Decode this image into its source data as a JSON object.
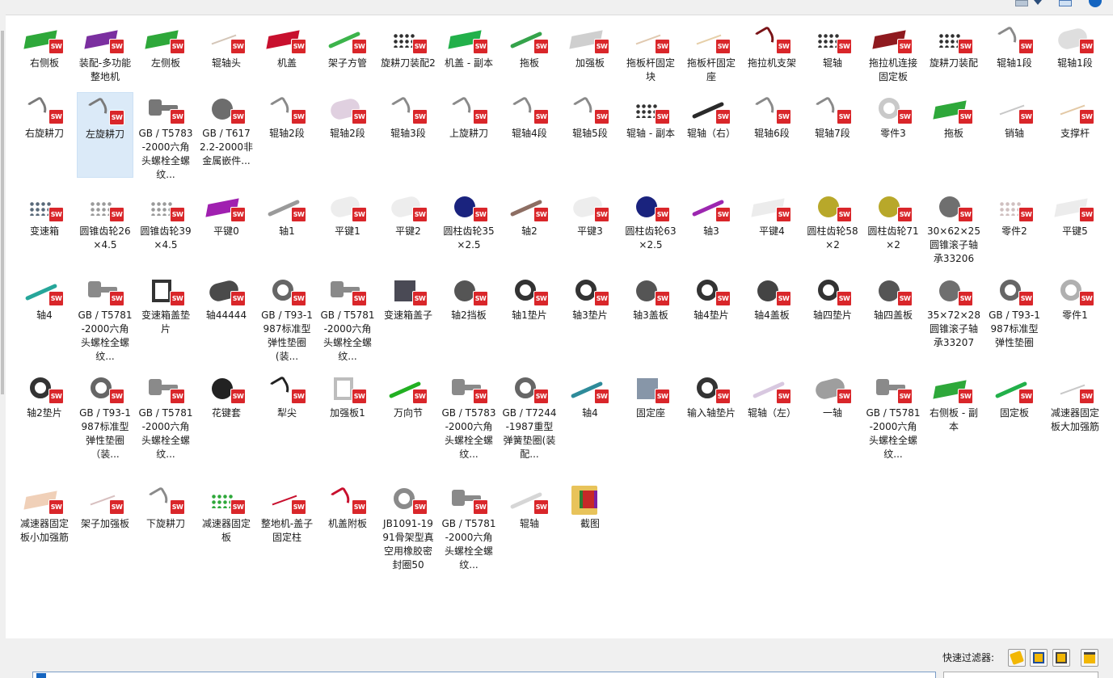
{
  "items": [
    {
      "label": "右侧板",
      "icon": "green-plate-part",
      "color": "#2ea83a",
      "shape": "slab"
    },
    {
      "label": "装配-多功能整地机",
      "icon": "purple-machine-assembly",
      "color": "#7b2fa0",
      "shape": "slab"
    },
    {
      "label": "左侧板",
      "icon": "green-plate-part",
      "color": "#2ea83a",
      "shape": "slab"
    },
    {
      "label": "辊轴头",
      "icon": "small-shaft-end-part",
      "color": "#d4c6b8",
      "shape": "thin"
    },
    {
      "label": "机盖",
      "icon": "red-cover-part",
      "color": "#c8102e",
      "shape": "slab"
    },
    {
      "label": "架子方管",
      "icon": "green-tube-part",
      "color": "#3cb44b",
      "shape": "rod"
    },
    {
      "label": "旋耕刀装配2",
      "icon": "tiller-blade-assembly",
      "color": "#2f2f2f",
      "shape": "dots"
    },
    {
      "label": "机盖 - 副本",
      "icon": "green-cover-part",
      "color": "#22b04a",
      "shape": "slab"
    },
    {
      "label": "拖板",
      "icon": "green-drag-board-part",
      "color": "#35a34b",
      "shape": "rod"
    },
    {
      "label": "加强板",
      "icon": "gray-reinforce-plate-part",
      "color": "#cfcfcf",
      "shape": "slab"
    },
    {
      "label": "拖板杆固定块",
      "icon": "small-block-part",
      "color": "#e0c9b0",
      "shape": "thin"
    },
    {
      "label": "拖板杆固定座",
      "icon": "small-seat-part",
      "color": "#e6cfa8",
      "shape": "thin"
    },
    {
      "label": "拖拉机支架",
      "icon": "dark-red-bracket-part",
      "color": "#7a1418",
      "shape": "blade"
    },
    {
      "label": "辊轴",
      "icon": "roller-shaft-blades",
      "color": "#333333",
      "shape": "dots"
    },
    {
      "label": "拖拉机连接固定板",
      "icon": "dark-red-plate-part",
      "color": "#8f1a1f",
      "shape": "slab"
    },
    {
      "label": "旋耕刀装配",
      "icon": "tiller-blade-assembly",
      "color": "#2f2f2f",
      "shape": "dots"
    },
    {
      "label": "辊轴1段",
      "icon": "gray-blade-part",
      "color": "#8a8a8a",
      "shape": "blade"
    },
    {
      "label": "辊轴1段",
      "icon": "gray-cylinder-part",
      "color": "#dedede",
      "shape": "cyl"
    },
    {
      "label": "右旋耕刀",
      "icon": "gray-blade-part",
      "color": "#7a7a7a",
      "shape": "blade"
    },
    {
      "label": "左旋耕刀",
      "icon": "gray-blade-part",
      "color": "#7a7a7a",
      "shape": "blade",
      "selected": true
    },
    {
      "label": "GB / T5783-2000六角头螺栓全螺纹...",
      "icon": "hex-bolt-part",
      "color": "#777777",
      "shape": "bolt"
    },
    {
      "label": "GB / T6172.2-2000非金属嵌件...",
      "icon": "hex-nut-part",
      "color": "#6d6d6d",
      "shape": "disk"
    },
    {
      "label": "辊轴2段",
      "icon": "gray-blade-part",
      "color": "#8a8a8a",
      "shape": "blade"
    },
    {
      "label": "辊轴2段",
      "icon": "gray-cylinder-part",
      "color": "#e0d0e0",
      "shape": "cyl"
    },
    {
      "label": "辊轴3段",
      "icon": "gray-blade-part",
      "color": "#8a8a8a",
      "shape": "blade"
    },
    {
      "label": "上旋耕刀",
      "icon": "gray-blade-part",
      "color": "#8a8a8a",
      "shape": "blade"
    },
    {
      "label": "辊轴4段",
      "icon": "gray-blade-part",
      "color": "#8a8a8a",
      "shape": "blade"
    },
    {
      "label": "辊轴5段",
      "icon": "gray-blade-part",
      "color": "#8a8a8a",
      "shape": "blade"
    },
    {
      "label": "辊轴 - 副本",
      "icon": "roller-shaft-blades",
      "color": "#333333",
      "shape": "dots"
    },
    {
      "label": "辊轴（右）",
      "icon": "black-rod-part",
      "color": "#2a2a2a",
      "shape": "rod"
    },
    {
      "label": "辊轴6段",
      "icon": "gray-blade-part",
      "color": "#8a8a8a",
      "shape": "blade"
    },
    {
      "label": "辊轴7段",
      "icon": "gray-blade-part",
      "color": "#8a8a8a",
      "shape": "blade"
    },
    {
      "label": "零件3",
      "icon": "gray-flange-part",
      "color": "#c9c9c9",
      "shape": "ring"
    },
    {
      "label": "拖板",
      "icon": "green-drag-board-part",
      "color": "#2ea83a",
      "shape": "slab"
    },
    {
      "label": "销轴",
      "icon": "small-pin-part",
      "color": "#c8c8c8",
      "shape": "thin"
    },
    {
      "label": "支撑杆",
      "icon": "small-rod-part",
      "color": "#e3c9a6",
      "shape": "thin"
    },
    {
      "label": "变速箱",
      "icon": "gearbox-assembly",
      "color": "#5a6a7a",
      "shape": "dots"
    },
    {
      "label": "圆锥齿轮26×4.5",
      "icon": "bevel-gear-part",
      "color": "#9a9a9a",
      "shape": "dots"
    },
    {
      "label": "圆锥齿轮39×4.5",
      "icon": "bevel-gear-part",
      "color": "#9a9a9a",
      "shape": "dots"
    },
    {
      "label": "平键0",
      "icon": "purple-key-part",
      "color": "#a020b0",
      "shape": "slab"
    },
    {
      "label": "轴1",
      "icon": "gray-shaft-part",
      "color": "#9a9a9a",
      "shape": "rod"
    },
    {
      "label": "平键1",
      "icon": "white-key-part",
      "color": "#ededed",
      "shape": "cyl"
    },
    {
      "label": "平键2",
      "icon": "white-key-part",
      "color": "#ededed",
      "shape": "cyl"
    },
    {
      "label": "圆柱齿轮35×2.5",
      "icon": "spur-gear-part",
      "color": "#1a237e",
      "shape": "disk"
    },
    {
      "label": "轴2",
      "icon": "brown-shaft-part",
      "color": "#8d6e63",
      "shape": "rod"
    },
    {
      "label": "平键3",
      "icon": "white-key-part",
      "color": "#ededed",
      "shape": "cyl"
    },
    {
      "label": "圆柱齿轮63×2.5",
      "icon": "spur-gear-part",
      "color": "#1a237e",
      "shape": "disk"
    },
    {
      "label": "轴3",
      "icon": "purple-shaft-part",
      "color": "#9c27b0",
      "shape": "rod"
    },
    {
      "label": "平键4",
      "icon": "white-key-part",
      "color": "#ececec",
      "shape": "slab"
    },
    {
      "label": "圆柱齿轮58×2",
      "icon": "olive-gear-part",
      "color": "#b8a82a",
      "shape": "disk"
    },
    {
      "label": "圆柱齿轮71×2",
      "icon": "olive-gear-part",
      "color": "#b8a82a",
      "shape": "disk"
    },
    {
      "label": "30×62×25圆锥滚子轴承33206",
      "icon": "bearing-part",
      "color": "#6f6f6f",
      "shape": "disk"
    },
    {
      "label": "零件2",
      "icon": "small-part",
      "color": "#d0c0c0",
      "shape": "dots"
    },
    {
      "label": "平键5",
      "icon": "white-key-part",
      "color": "#ececec",
      "shape": "slab"
    },
    {
      "label": "轴4",
      "icon": "teal-shaft-part",
      "color": "#26a69a",
      "shape": "rod"
    },
    {
      "label": "GB / T5781-2000六角头螺栓全螺纹...",
      "icon": "hex-bolt-part",
      "color": "#8a8a8a",
      "shape": "bolt"
    },
    {
      "label": "变速箱盖垫片",
      "icon": "gasket-frame-part",
      "color": "#333333",
      "shape": "frame"
    },
    {
      "label": "轴44444",
      "icon": "dark-cylinder-part",
      "color": "#4a4a4a",
      "shape": "cyl"
    },
    {
      "label": "GB / T93-1987标准型弹性垫圈(装...",
      "icon": "spring-washer-part",
      "color": "#666666",
      "shape": "ring"
    },
    {
      "label": "GB / T5781-2000六角头螺栓全螺纹...",
      "icon": "hex-bolt-part",
      "color": "#8a8a8a",
      "shape": "bolt"
    },
    {
      "label": "变速箱盖子",
      "icon": "dark-plate-part",
      "color": "#4a4a55",
      "shape": "square"
    },
    {
      "label": "轴2挡板",
      "icon": "dark-disk-part",
      "color": "#555555",
      "shape": "disk"
    },
    {
      "label": "轴1垫片",
      "icon": "black-ring-part",
      "color": "#333333",
      "shape": "ring"
    },
    {
      "label": "轴3垫片",
      "icon": "black-ring-part",
      "color": "#333333",
      "shape": "ring"
    },
    {
      "label": "轴3盖板",
      "icon": "dark-disk-part",
      "color": "#555555",
      "shape": "disk"
    },
    {
      "label": "轴4垫片",
      "icon": "black-ring-part",
      "color": "#333333",
      "shape": "ring"
    },
    {
      "label": "轴4盖板",
      "icon": "dark-disk-part",
      "color": "#444444",
      "shape": "disk"
    },
    {
      "label": "轴四垫片",
      "icon": "black-ring-part",
      "color": "#333333",
      "shape": "ring"
    },
    {
      "label": "轴四盖板",
      "icon": "dark-disk-part",
      "color": "#555555",
      "shape": "disk"
    },
    {
      "label": "35×72×28圆锥滚子轴承33207",
      "icon": "bearing-part",
      "color": "#6f6f6f",
      "shape": "disk"
    },
    {
      "label": "GB / T93-1987标准型弹性垫圈",
      "icon": "spring-washer-part",
      "color": "#666666",
      "shape": "ring"
    },
    {
      "label": "零件1",
      "icon": "gray-ring-part",
      "color": "#b0b0b0",
      "shape": "ring"
    },
    {
      "label": "轴2垫片",
      "icon": "black-ring-part",
      "color": "#333333",
      "shape": "ring"
    },
    {
      "label": "GB / T93-1987标准型弹性垫圈（装...",
      "icon": "spring-washer-part",
      "color": "#666666",
      "shape": "ring"
    },
    {
      "label": "GB / T5781-2000六角头螺栓全螺纹...",
      "icon": "hex-bolt-part",
      "color": "#8a8a8a",
      "shape": "bolt"
    },
    {
      "label": "花键套",
      "icon": "spline-sleeve-part",
      "color": "#222222",
      "shape": "disk"
    },
    {
      "label": "犁尖",
      "icon": "plow-tip-part",
      "color": "#222222",
      "shape": "blade"
    },
    {
      "label": "加强板1",
      "icon": "gray-bracket-part",
      "color": "#bdbdbd",
      "shape": "frame"
    },
    {
      "label": "万向节",
      "icon": "green-universal-joint-part",
      "color": "#22b022",
      "shape": "rod"
    },
    {
      "label": "GB / T5783-2000六角头螺栓全螺纹...",
      "icon": "hex-bolt-part",
      "color": "#8a8a8a",
      "shape": "bolt"
    },
    {
      "label": "GB / T7244-1987重型弹簧垫圈(装配...",
      "icon": "spring-washer-part",
      "color": "#666666",
      "shape": "ring"
    },
    {
      "label": "轴4",
      "icon": "teal-shaft-part",
      "color": "#2e8b9a",
      "shape": "rod"
    },
    {
      "label": "固定座",
      "icon": "gray-seat-part",
      "color": "#8796a8",
      "shape": "square"
    },
    {
      "label": "输入轴垫片",
      "icon": "black-ring-part",
      "color": "#333333",
      "shape": "ring"
    },
    {
      "label": "辊轴（左）",
      "icon": "white-rod-part",
      "color": "#d8c8e0",
      "shape": "rod"
    },
    {
      "label": "一轴",
      "icon": "gray-shaft-part",
      "color": "#9e9e9e",
      "shape": "cyl"
    },
    {
      "label": "GB / T5781-2000六角头螺栓全螺纹...",
      "icon": "hex-bolt-part",
      "color": "#8a8a8a",
      "shape": "bolt"
    },
    {
      "label": "右侧板 - 副本",
      "icon": "green-plate-part",
      "color": "#2ea83a",
      "shape": "slab"
    },
    {
      "label": "固定板",
      "icon": "green-fixed-plate-part",
      "color": "#22b04a",
      "shape": "rod"
    },
    {
      "label": "减速器固定板大加强筋",
      "icon": "small-rib-part",
      "color": "#c8c8c8",
      "shape": "thin"
    },
    {
      "label": "减速器固定板小加强筋",
      "icon": "small-rib-part",
      "color": "#f0d0b8",
      "shape": "slab"
    },
    {
      "label": "架子加强板",
      "icon": "small-plate-part",
      "color": "#d8c0c0",
      "shape": "thin"
    },
    {
      "label": "下旋耕刀",
      "icon": "gray-blade-part",
      "color": "#8a8a8a",
      "shape": "blade"
    },
    {
      "label": "减速器固定板",
      "icon": "green-small-plate-part",
      "color": "#2ea83a",
      "shape": "dots"
    },
    {
      "label": "整地机-盖子固定柱",
      "icon": "red-pillar-part",
      "color": "#c8102e",
      "shape": "thin"
    },
    {
      "label": "机盖附板",
      "icon": "red-cover-plate-part",
      "color": "#c8102e",
      "shape": "blade"
    },
    {
      "label": "JB1091-1991骨架型真空用橡胶密封圈50",
      "icon": "rubber-seal-ring-part",
      "color": "#8a8a8a",
      "shape": "ring"
    },
    {
      "label": "GB / T5781-2000六角头螺栓全螺纹...",
      "icon": "hex-bolt-part",
      "color": "#8a8a8a",
      "shape": "bolt"
    },
    {
      "label": "辊轴",
      "icon": "white-rod-part",
      "color": "#d6d6d6",
      "shape": "rod"
    },
    {
      "label": "截图",
      "icon": "screenshot-folder",
      "color": "#e8c35a",
      "shape": "folder"
    }
  ],
  "sw_badge": "SW",
  "status": {
    "filter_label": "快速过滤器:",
    "filter_buttons": [
      "filter-parts-icon",
      "filter-assemblies-icon",
      "filter-drawings-icon",
      "filter-open-docs-icon"
    ]
  }
}
